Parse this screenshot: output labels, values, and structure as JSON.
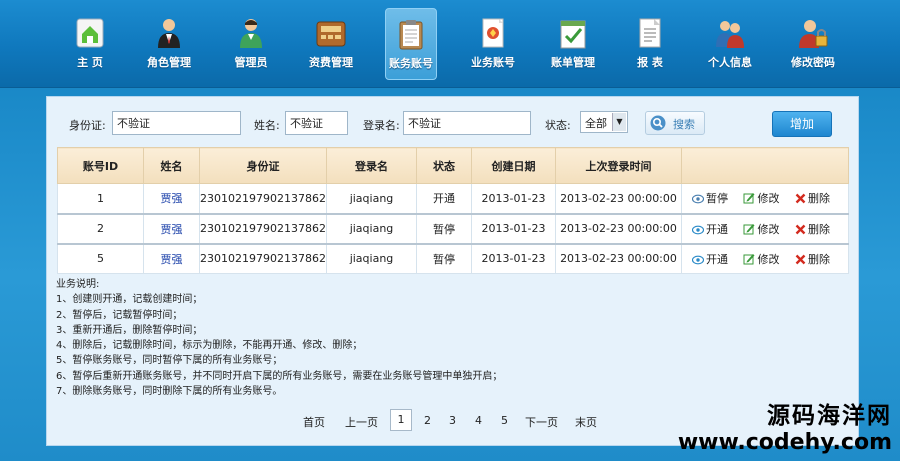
{
  "nav": [
    {
      "label": "主 页",
      "icon": "home-icon"
    },
    {
      "label": "角色管理",
      "icon": "role-icon"
    },
    {
      "label": "管理员",
      "icon": "admin-icon"
    },
    {
      "label": "资费管理",
      "icon": "fee-icon"
    },
    {
      "label": "账务账号",
      "icon": "account-icon",
      "active": true
    },
    {
      "label": "业务账号",
      "icon": "service-icon"
    },
    {
      "label": "账单管理",
      "icon": "bill-icon"
    },
    {
      "label": "报 表",
      "icon": "report-icon"
    },
    {
      "label": "个人信息",
      "icon": "user-info-icon"
    },
    {
      "label": "修改密码",
      "icon": "password-icon"
    }
  ],
  "filter": {
    "idcard_label": "身份证:",
    "idcard_value": "不验证",
    "name_label": "姓名:",
    "name_value": "不验证",
    "login_label": "登录名:",
    "login_value": "不验证",
    "status_label": "状态:",
    "status_value": "全部",
    "search_label": "搜索",
    "add_label": "增加"
  },
  "table": {
    "headers": [
      "账号ID",
      "姓名",
      "身份证",
      "登录名",
      "状态",
      "创建日期",
      "上次登录时间",
      ""
    ],
    "rows": [
      {
        "id": "1",
        "name": "贾强",
        "idcard": "230102197902137862",
        "login": "jiaqiang",
        "status": "开通",
        "created": "2013-01-23",
        "last_login": "2013-02-23 00:00:00",
        "toggle": "暂停",
        "edit": "修改",
        "delete": "删除"
      },
      {
        "id": "2",
        "name": "贾强",
        "idcard": "230102197902137862",
        "login": "jiaqiang",
        "status": "暂停",
        "created": "2013-01-23",
        "last_login": "2013-02-23 00:00:00",
        "toggle": "开通",
        "edit": "修改",
        "delete": "删除"
      },
      {
        "id": "5",
        "name": "贾强",
        "idcard": "230102197902137862",
        "login": "jiaqiang",
        "status": "暂停",
        "created": "2013-01-23",
        "last_login": "2013-02-23 00:00:00",
        "toggle": "开通",
        "edit": "修改",
        "delete": "删除"
      }
    ]
  },
  "notes": [
    "业务说明:",
    "1、创建则开通，记载创建时间；",
    "2、暂停后，记载暂停时间；",
    "3、重新开通后，删除暂停时间；",
    "4、删除后，记载删除时间，标示为删除，不能再开通、修改、删除；",
    "5、暂停账务账号，同时暂停下属的所有业务账号；",
    "6、暂停后重新开通账务账号，并不同时开启下属的所有业务账号，需要在业务账号管理中单独开启；",
    "7、删除账务账号，同时删除下属的所有业务账号。"
  ],
  "pager": {
    "first": "首页",
    "prev": "上一页",
    "pages": [
      "1",
      "2",
      "3",
      "4",
      "5"
    ],
    "current": "1",
    "next": "下一页",
    "last": "末页"
  },
  "watermark": {
    "line1": "源码海洋网",
    "line2": "www.codehy.com"
  }
}
